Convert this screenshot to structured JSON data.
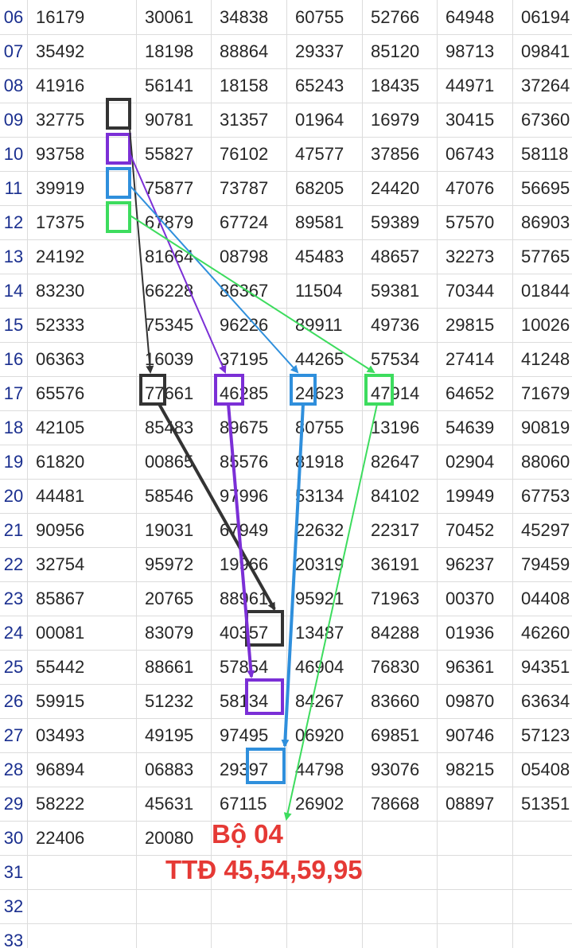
{
  "rows": [
    {
      "num": "06",
      "cells": [
        "16179",
        "30061",
        "34838",
        "60755",
        "52766",
        "64948",
        "06194"
      ]
    },
    {
      "num": "07",
      "cells": [
        "35492",
        "18198",
        "88864",
        "29337",
        "85120",
        "98713",
        "09841"
      ]
    },
    {
      "num": "08",
      "cells": [
        "41916",
        "56141",
        "18158",
        "65243",
        "18435",
        "44971",
        "37264"
      ]
    },
    {
      "num": "09",
      "cells": [
        "32775",
        "90781",
        "31357",
        "01964",
        "16979",
        "30415",
        "67360"
      ]
    },
    {
      "num": "10",
      "cells": [
        "93758",
        "55827",
        "76102",
        "47577",
        "37856",
        "06743",
        "58118"
      ]
    },
    {
      "num": "11",
      "cells": [
        "39919",
        "75877",
        "73787",
        "68205",
        "24420",
        "47076",
        "56695"
      ]
    },
    {
      "num": "12",
      "cells": [
        "17375",
        "67879",
        "67724",
        "89581",
        "59389",
        "57570",
        "86903"
      ]
    },
    {
      "num": "13",
      "cells": [
        "24192",
        "81664",
        "08798",
        "45483",
        "48657",
        "32273",
        "57765"
      ]
    },
    {
      "num": "14",
      "cells": [
        "83230",
        "66228",
        "86367",
        "11504",
        "59381",
        "70344",
        "01844"
      ]
    },
    {
      "num": "15",
      "cells": [
        "52333",
        "75345",
        "96226",
        "89911",
        "49736",
        "29815",
        "10026"
      ]
    },
    {
      "num": "16",
      "cells": [
        "06363",
        "16039",
        "37195",
        "44265",
        "57534",
        "27414",
        "41248"
      ]
    },
    {
      "num": "17",
      "cells": [
        "65576",
        "77661",
        "46285",
        "24623",
        "47914",
        "64652",
        "71679"
      ]
    },
    {
      "num": "18",
      "cells": [
        "42105",
        "85483",
        "89675",
        "80755",
        "13196",
        "54639",
        "90819"
      ]
    },
    {
      "num": "19",
      "cells": [
        "61820",
        "00865",
        "85576",
        "81918",
        "82647",
        "02904",
        "88060"
      ]
    },
    {
      "num": "20",
      "cells": [
        "44481",
        "58546",
        "97996",
        "53134",
        "84102",
        "19949",
        "67753"
      ]
    },
    {
      "num": "21",
      "cells": [
        "90956",
        "19031",
        "67949",
        "22632",
        "22317",
        "70452",
        "45297"
      ]
    },
    {
      "num": "22",
      "cells": [
        "32754",
        "95972",
        "19966",
        "20319",
        "36191",
        "96237",
        "79459"
      ]
    },
    {
      "num": "23",
      "cells": [
        "85867",
        "20765",
        "88961",
        "95921",
        "71963",
        "00370",
        "04408"
      ]
    },
    {
      "num": "24",
      "cells": [
        "00081",
        "83079",
        "40357",
        "13487",
        "84288",
        "01936",
        "46260"
      ]
    },
    {
      "num": "25",
      "cells": [
        "55442",
        "88661",
        "57854",
        "46904",
        "76830",
        "96361",
        "94351"
      ]
    },
    {
      "num": "26",
      "cells": [
        "59915",
        "51232",
        "58134",
        "84267",
        "83660",
        "09870",
        "63634"
      ]
    },
    {
      "num": "27",
      "cells": [
        "03493",
        "49195",
        "97495",
        "06920",
        "69851",
        "90746",
        "57123"
      ]
    },
    {
      "num": "28",
      "cells": [
        "96894",
        "06883",
        "29397",
        "44798",
        "93076",
        "98215",
        "05408"
      ]
    },
    {
      "num": "29",
      "cells": [
        "58222",
        "45631",
        "67115",
        "26902",
        "78668",
        "08897",
        "51351"
      ]
    },
    {
      "num": "30",
      "cells": [
        "22406",
        "20080",
        "",
        "",
        "",
        "",
        ""
      ]
    },
    {
      "num": "31",
      "cells": [
        "",
        "",
        "",
        "",
        "",
        "",
        ""
      ]
    },
    {
      "num": "32",
      "cells": [
        "",
        "",
        "",
        "",
        "",
        "",
        ""
      ]
    },
    {
      "num": "33",
      "cells": [
        "",
        "",
        "",
        "",
        "",
        "",
        ""
      ]
    }
  ],
  "annotations": {
    "title": "Bộ 04",
    "subtitle": "TTĐ 45,54,59,95"
  },
  "colors": {
    "black": "#333333",
    "purple": "#7b2fd6",
    "blue": "#2f8fdc",
    "green": "#3ddc5e",
    "note_red": "#e53935"
  }
}
